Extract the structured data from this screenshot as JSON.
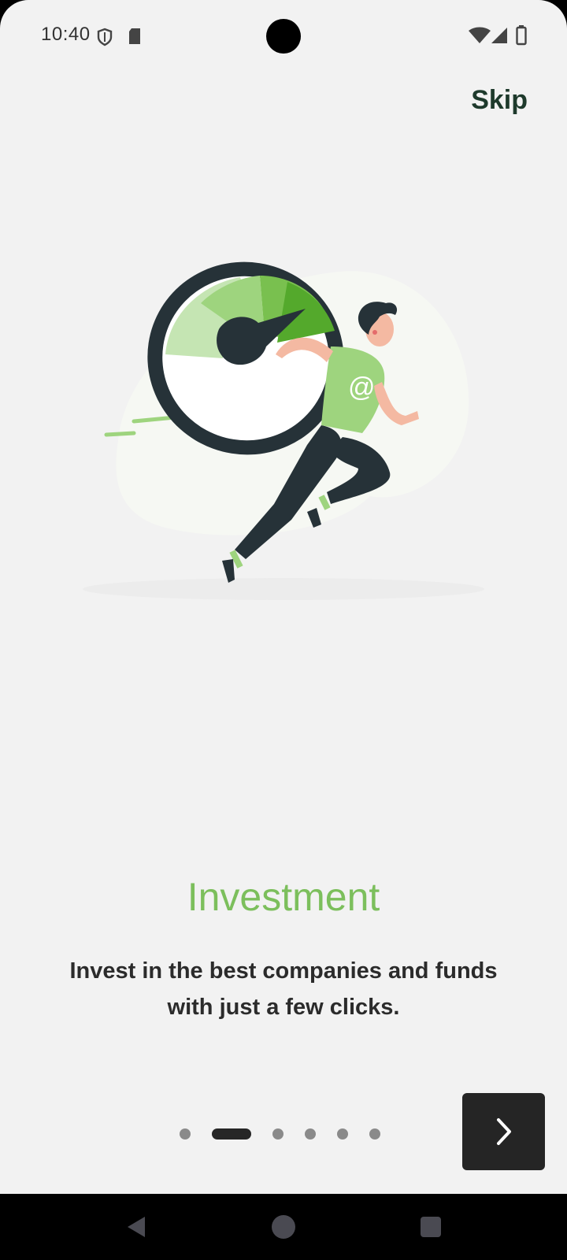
{
  "status_bar": {
    "time": "10:40",
    "icons": [
      "shield-icon",
      "sd-card-icon",
      "wifi-icon",
      "cell-signal-icon",
      "battery-icon"
    ]
  },
  "header": {
    "skip_label": "Skip"
  },
  "onboarding": {
    "title": "Investment",
    "description": "Invest in the best companies and funds with just a few clicks.",
    "page_count": 6,
    "active_page_index": 1
  },
  "navigation_bar": {
    "icons": [
      "back-icon",
      "home-icon",
      "recents-icon"
    ]
  },
  "colors": {
    "background": "#f2f2f2",
    "title_green": "#7cbf5c",
    "dark": "#252525",
    "skip_text": "#1e3a2c"
  }
}
